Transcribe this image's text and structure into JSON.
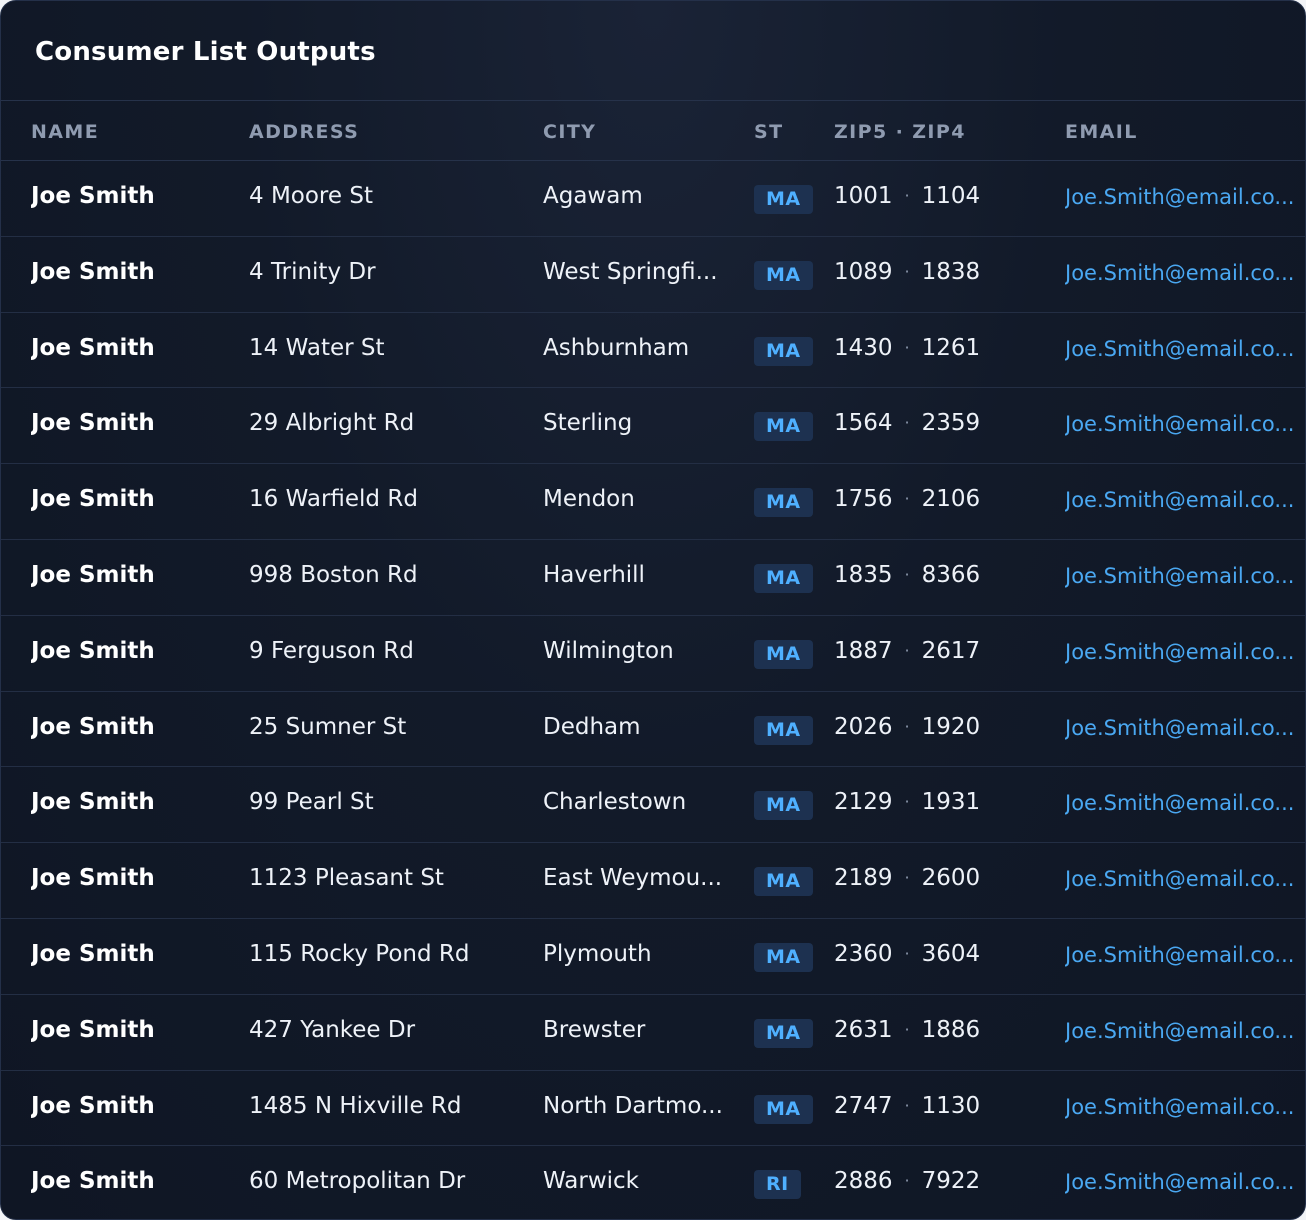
{
  "panel": {
    "title": "Consumer List Outputs"
  },
  "columns": {
    "name": "NAME",
    "address": "ADDRESS",
    "city": "CITY",
    "state": "ST",
    "zip": "ZIP5 · ZIP4",
    "email": "EMAIL"
  },
  "zip_separator": "·",
  "rows": [
    {
      "name": "Joe Smith",
      "address": "4 Moore St",
      "city": "Agawam",
      "state": "MA",
      "zip5": "1001",
      "zip4": "1104",
      "email": "Joe.Smith@email.co..."
    },
    {
      "name": "Joe Smith",
      "address": "4 Trinity Dr",
      "city": "West Springfi...",
      "state": "MA",
      "zip5": "1089",
      "zip4": "1838",
      "email": "Joe.Smith@email.co..."
    },
    {
      "name": "Joe Smith",
      "address": "14 Water St",
      "city": "Ashburnham",
      "state": "MA",
      "zip5": "1430",
      "zip4": "1261",
      "email": "Joe.Smith@email.co..."
    },
    {
      "name": "Joe Smith",
      "address": "29 Albright Rd",
      "city": "Sterling",
      "state": "MA",
      "zip5": "1564",
      "zip4": "2359",
      "email": "Joe.Smith@email.co..."
    },
    {
      "name": "Joe Smith",
      "address": "16 Warfield Rd",
      "city": "Mendon",
      "state": "MA",
      "zip5": "1756",
      "zip4": "2106",
      "email": "Joe.Smith@email.co..."
    },
    {
      "name": "Joe Smith",
      "address": "998 Boston Rd",
      "city": "Haverhill",
      "state": "MA",
      "zip5": "1835",
      "zip4": "8366",
      "email": "Joe.Smith@email.co..."
    },
    {
      "name": "Joe Smith",
      "address": "9 Ferguson Rd",
      "city": "Wilmington",
      "state": "MA",
      "zip5": "1887",
      "zip4": "2617",
      "email": "Joe.Smith@email.co..."
    },
    {
      "name": "Joe Smith",
      "address": "25 Sumner St",
      "city": "Dedham",
      "state": "MA",
      "zip5": "2026",
      "zip4": "1920",
      "email": "Joe.Smith@email.co..."
    },
    {
      "name": "Joe Smith",
      "address": "99 Pearl St",
      "city": "Charlestown",
      "state": "MA",
      "zip5": "2129",
      "zip4": "1931",
      "email": "Joe.Smith@email.co..."
    },
    {
      "name": "Joe Smith",
      "address": "1123 Pleasant St",
      "city": "East Weymou...",
      "state": "MA",
      "zip5": "2189",
      "zip4": "2600",
      "email": "Joe.Smith@email.co..."
    },
    {
      "name": "Joe Smith",
      "address": "115 Rocky Pond Rd",
      "city": "Plymouth",
      "state": "MA",
      "zip5": "2360",
      "zip4": "3604",
      "email": "Joe.Smith@email.co..."
    },
    {
      "name": "Joe Smith",
      "address": "427 Yankee Dr",
      "city": "Brewster",
      "state": "MA",
      "zip5": "2631",
      "zip4": "1886",
      "email": "Joe.Smith@email.co..."
    },
    {
      "name": "Joe Smith",
      "address": "1485 N Hixville Rd",
      "city": "North Dartmo...",
      "state": "MA",
      "zip5": "2747",
      "zip4": "1130",
      "email": "Joe.Smith@email.co..."
    },
    {
      "name": "Joe Smith",
      "address": "60 Metropolitan Dr",
      "city": "Warwick",
      "state": "RI",
      "zip5": "2886",
      "zip4": "7922",
      "email": "Joe.Smith@email.co..."
    }
  ]
}
